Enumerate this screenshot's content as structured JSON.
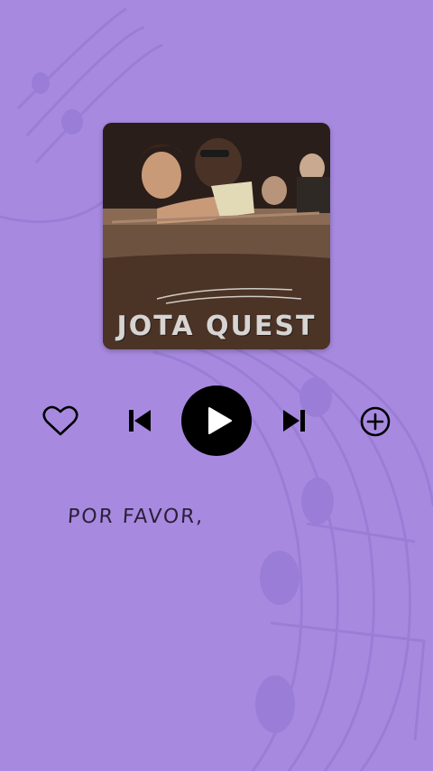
{
  "colors": {
    "background": "#a78ae0",
    "staff": "#8f72cc",
    "control": "#000000"
  },
  "album": {
    "cover_text": "JOTA QUEST"
  },
  "controls": {
    "like_icon": "heart-outline-icon",
    "previous_icon": "skip-previous-icon",
    "play_icon": "play-icon",
    "next_icon": "skip-next-icon",
    "add_icon": "add-circle-icon"
  },
  "lyrics": {
    "current_line": "POR FAVOR,"
  }
}
